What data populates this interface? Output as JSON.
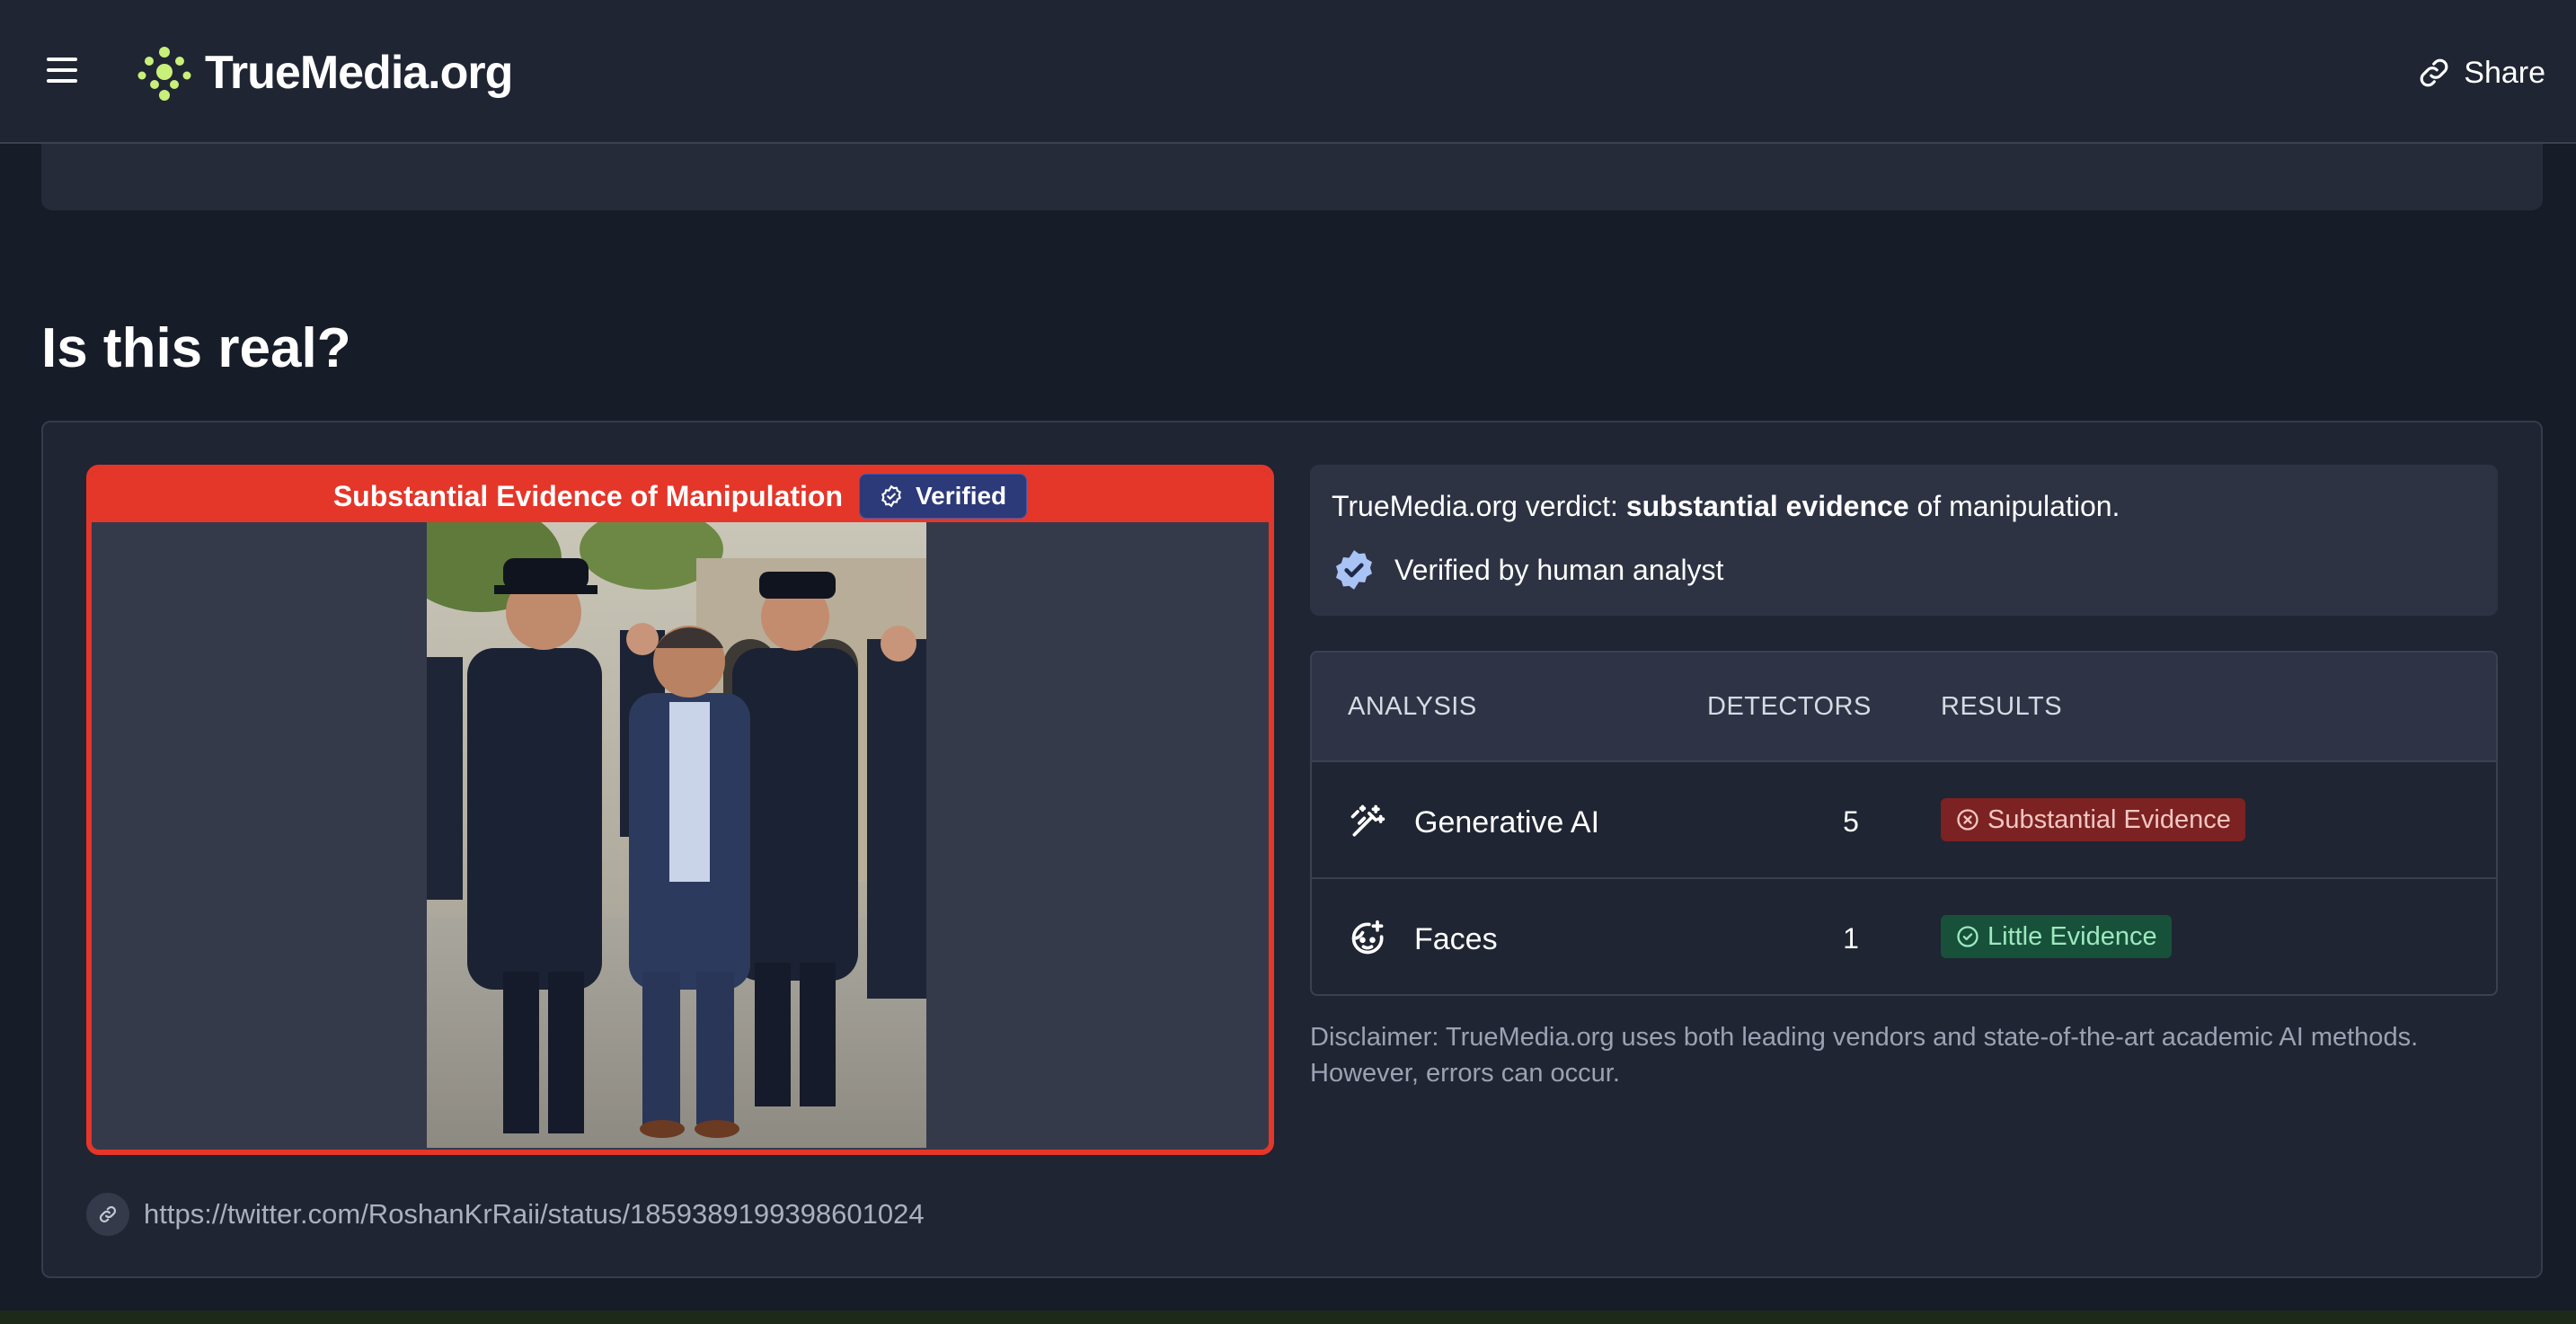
{
  "header": {
    "logo_text": "TrueMedia.org",
    "share_label": "Share"
  },
  "page": {
    "title": "Is this real?"
  },
  "media": {
    "banner_text": "Substantial Evidence of Manipulation",
    "verified_label": "Verified",
    "source_url": "https://twitter.com/RoshanKrRaii/status/1859389199398601024"
  },
  "verdict": {
    "prefix": "TrueMedia.org verdict: ",
    "strong": "substantial evidence",
    "suffix": " of manipulation.",
    "human_verified": "Verified by human analyst"
  },
  "table": {
    "headers": [
      "ANALYSIS",
      "DETECTORS",
      "RESULTS"
    ],
    "rows": [
      {
        "analysis": "Generative AI",
        "detectors": "5",
        "result": "Substantial Evidence",
        "icon": "magic-wand-icon",
        "status_color": "#7c2222"
      },
      {
        "analysis": "Faces",
        "detectors": "1",
        "result": "Little Evidence",
        "icon": "face-icon",
        "status_color": "#17513a"
      }
    ]
  },
  "disclaimer": "Disclaimer: TrueMedia.org uses both leading vendors and state-of-the-art academic AI methods. However, errors can occur.",
  "colors": {
    "accent_red": "#e5362a",
    "verified_blue": "#2c3a7a",
    "logo_green": "#c8f07a"
  }
}
